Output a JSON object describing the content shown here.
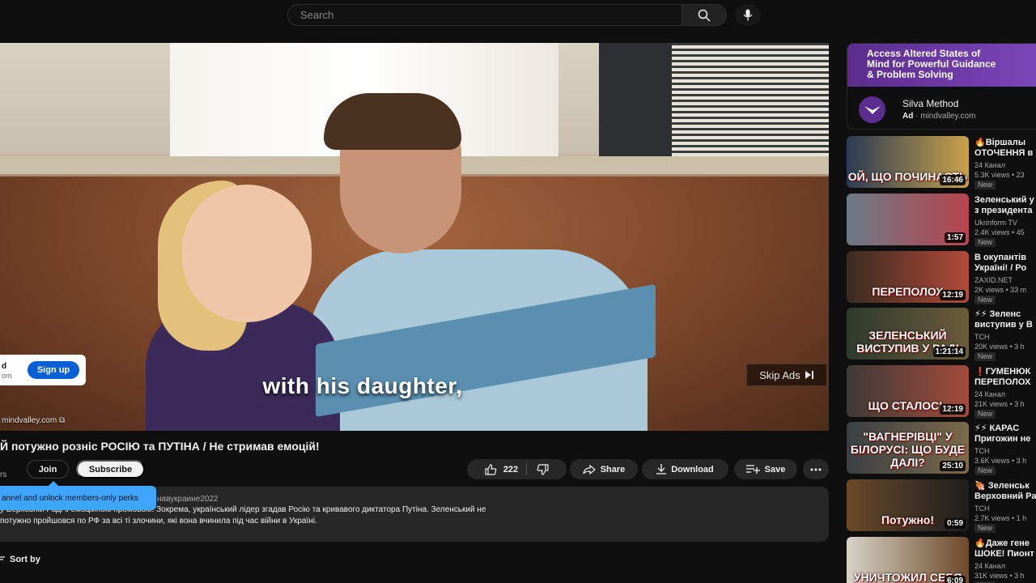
{
  "search": {
    "placeholder": "Search"
  },
  "player": {
    "subtitle": "with his daughter,",
    "ad_signup_line1": "d",
    "ad_signup_line2": "om",
    "ad_signup_button": "Sign up",
    "ad_domain": "mindvalley.com",
    "skip_ads": "Skip Ads"
  },
  "video": {
    "title": "Й потужно розніс РОСІЮ та ПУТІНА / Не стримав емоцій!",
    "subscriber_fragment": "rs",
    "join_label": "Join",
    "subscribe_label": "Subscribe",
    "likes": "222",
    "share_label": "Share",
    "download_label": "Download",
    "save_label": "Save"
  },
  "description": {
    "tags": "навукраине2022",
    "line1": "у Верховній Раді з емоційною промовою. Зокрема, український лідер згадав Росію та кривавого диктатора Путіна. Зеленський не",
    "line2": "потужно пройшовся по РФ за всі ті злочини, які вона вчинила під час війни в Україні.",
    "tooltip": "annel and unlock members-only perks"
  },
  "comments": {
    "sort_label": "Sort by"
  },
  "sidebar_ad": {
    "banner_line1": "Access Altered States of",
    "banner_line2": "Mind for Powerful Guidance",
    "banner_line3": "& Problem Solving",
    "name": "Silva Method",
    "ad_label": "Ad",
    "domain": "mindvalley.com"
  },
  "recommendations": [
    {
      "title": "🔥Віршалы ОТОЧЕННЯ в",
      "channel": "24 Канал",
      "views": "5.3K views • 23",
      "badge": "New",
      "duration": "16:46",
      "thumb_text": "ОЙ, ЩО ПОЧИНАЄТЬ",
      "colors": [
        "#2b3a55",
        "#c9a24a"
      ]
    },
    {
      "title": "Зеленський у з президента",
      "channel": "Ukrinform TV",
      "views": "2.4K views • 45",
      "badge": "New",
      "duration": "1:57",
      "thumb_text": "",
      "colors": [
        "#6b7b86",
        "#b9434e"
      ]
    },
    {
      "title": "В окупантів Україні! / Ро",
      "channel": "ZAXID.NET",
      "views": "2K views • 33 m",
      "badge": "New",
      "duration": "12:19",
      "thumb_text": "ПЕРЕПОЛОХ",
      "colors": [
        "#3a2b20",
        "#b24a3a"
      ]
    },
    {
      "title": "⚡⚡ Зеленс виступив у В",
      "channel": "ТСН",
      "views": "20K views • 3 h",
      "badge": "New",
      "duration": "1:21:14",
      "thumb_text": "ЗЕЛЕНСЬКИЙ ВИСТУПИВ У РАДІ",
      "colors": [
        "#2f3a2c",
        "#6b5b3a"
      ]
    },
    {
      "title": "❗ГУМЕНЮК ПЕРЕПОЛОХ",
      "channel": "24 Канал",
      "views": "21K views • 3 h",
      "badge": "New",
      "duration": "12:19",
      "thumb_text": "ЩО СТАЛОСЬ",
      "colors": [
        "#3d3a38",
        "#a44b3b"
      ]
    },
    {
      "title": "⚡⚡ КАРАС Пригожин не",
      "channel": "ТСН",
      "views": "3.6K views • 3 h",
      "badge": "New",
      "duration": "25:10",
      "thumb_text": "\"ВАГНЕРІВЦІ\" У БІЛОРУСІ: ЩО БУДЕ ДАЛІ?",
      "colors": [
        "#3b3f43",
        "#7c6a4a"
      ]
    },
    {
      "title": "🍖 Зеленськ Верховний Ра",
      "channel": "ТСН",
      "views": "2.7K views • 1 h",
      "badge": "New",
      "duration": "0:59",
      "thumb_text": "Потужно!",
      "colors": [
        "#6a4a2a",
        "#1d1d1d"
      ]
    },
    {
      "title": "🔥Даже гене ШОКЕ! Пионт",
      "channel": "24 Канал",
      "views": "31K views • 3 h",
      "badge": "New",
      "duration": "6:09",
      "thumb_text": "УНИЧТОЖИЛ СЕБЯ",
      "colors": [
        "#d8d2c8",
        "#6d4a2a"
      ]
    }
  ]
}
